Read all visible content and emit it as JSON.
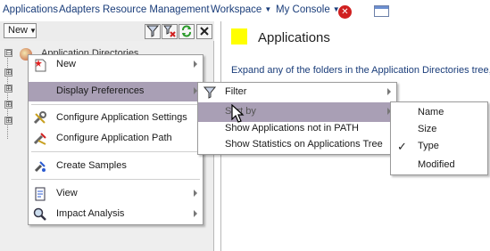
{
  "menubar": {
    "items": [
      {
        "label": "Applications",
        "dropdown": false
      },
      {
        "label": "Adapters",
        "dropdown": false
      },
      {
        "label": "Resource Management",
        "dropdown": false
      },
      {
        "label": "Workspace",
        "dropdown": true
      },
      {
        "label": "My Console",
        "dropdown": true
      }
    ],
    "close_icon": "close-circle-icon",
    "window_icon": "window-icon"
  },
  "toolbar": {
    "new_label": "New",
    "icons": [
      "filter-icon",
      "preferences-icon",
      "refresh-icon",
      "close-icon"
    ]
  },
  "tree": {
    "root_label": "Application Directories",
    "expanders": [
      "⊟",
      "⊞",
      "⊞",
      "⊞",
      "⊞"
    ]
  },
  "main": {
    "title": "Applications",
    "description": "Expand any of the folders in the Application Directories tree,",
    "accent_color": "#ffff00"
  },
  "context_menu": {
    "items": [
      {
        "label": "New",
        "icon": "new-star-icon",
        "submenu": true
      },
      {
        "label": "Display Preferences",
        "icon": "",
        "submenu": true,
        "highlighted": true
      },
      {
        "label": "Configure Application Settings",
        "icon": "tools-icon",
        "submenu": false
      },
      {
        "label": "Configure Application Path",
        "icon": "path-config-icon",
        "submenu": false
      },
      {
        "label": "Create Samples",
        "icon": "samples-icon",
        "submenu": false
      },
      {
        "label": "View",
        "icon": "document-view-icon",
        "submenu": true
      },
      {
        "label": "Impact Analysis",
        "icon": "magnifier-icon",
        "submenu": true
      }
    ]
  },
  "display_preferences_menu": {
    "items": [
      {
        "label": "Filter",
        "icon": "filter-icon",
        "submenu": true
      },
      {
        "label": "Sort by",
        "icon": "",
        "submenu": true,
        "highlighted": true
      },
      {
        "label": "Show Applications not in PATH",
        "submenu": false
      },
      {
        "label": "Show Statistics on Applications Tree",
        "submenu": false
      }
    ]
  },
  "sort_by_menu": {
    "items": [
      {
        "label": "Name",
        "checked": false
      },
      {
        "label": "Size",
        "checked": false
      },
      {
        "label": "Type",
        "checked": true
      },
      {
        "label": "Modified",
        "checked": false
      }
    ],
    "check_glyph": "✓"
  },
  "colors": {
    "menu_highlight": "#a99fb5",
    "link_text": "#1a3d7a",
    "panel_bg": "#eeeeee"
  }
}
